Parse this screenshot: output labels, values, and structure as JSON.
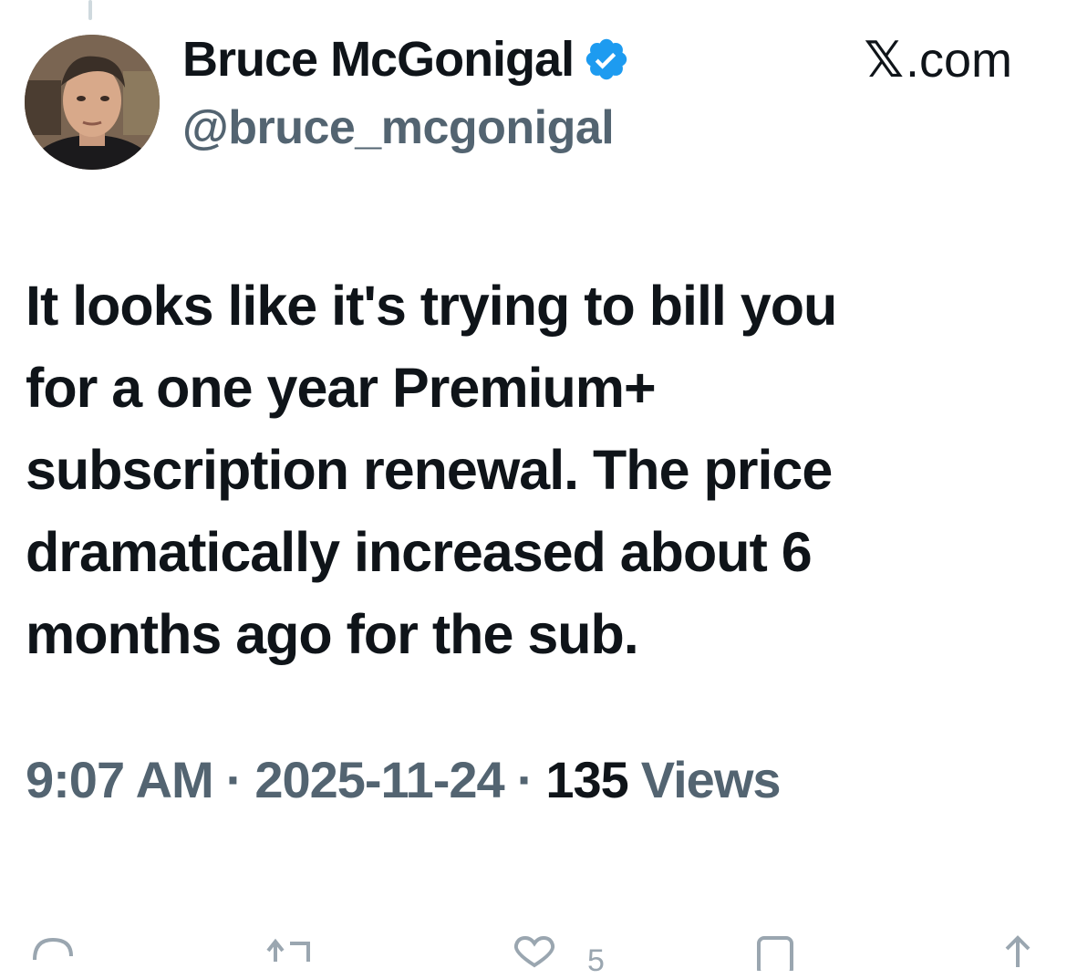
{
  "tweet": {
    "author": {
      "display_name": "Bruce McGonigal",
      "handle": "@bruce_mcgonigal",
      "verified": true,
      "avatar_icon": "profile-photo"
    },
    "source": {
      "logo_glyph": "𝕏",
      "domain_suffix": ".com"
    },
    "text": "It looks like it's trying to bill you\nfor a one year Premium+\nsubscription renewal. The price\ndramatically increased about 6\nmonths ago for the sub.",
    "meta": {
      "time": "9:07 AM",
      "separator": "·",
      "date": "2025-11-24",
      "views_count": "135",
      "views_label": "Views"
    },
    "actions": {
      "like_count": "5"
    }
  },
  "colors": {
    "text_primary": "#0f1419",
    "text_secondary": "#536471",
    "verified_blue": "#1d9bf0",
    "action_icon": "#9aa6b0"
  }
}
